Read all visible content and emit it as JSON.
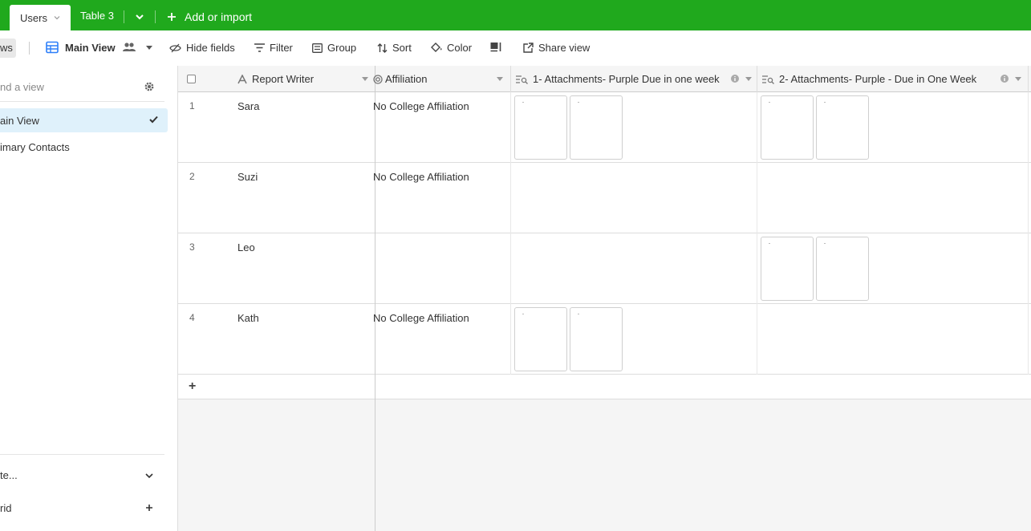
{
  "tabs": {
    "active": "Users",
    "other": "Table 3",
    "add_import": "Add or import"
  },
  "toolbar": {
    "views_label": "ws",
    "view_name": "Main View",
    "hide_fields": "Hide fields",
    "filter": "Filter",
    "group": "Group",
    "sort": "Sort",
    "color": "Color",
    "share_view": "Share view"
  },
  "sidebar": {
    "find_placeholder": "nd a view",
    "items": [
      {
        "label": "ain View",
        "active": true
      },
      {
        "label": "imary Contacts",
        "active": false
      }
    ],
    "bottom": [
      {
        "label": "te...",
        "icon": "chevron-down-icon"
      },
      {
        "label": "rid",
        "icon": "plus-icon"
      }
    ]
  },
  "grid": {
    "columns": [
      {
        "label": "Report Writer",
        "icon": "text-field-icon"
      },
      {
        "label": "Affiliation",
        "icon": "link-field-icon"
      },
      {
        "label": "1- Attachments- Purple Due in one week",
        "icon": "lookup-field-icon"
      },
      {
        "label": "2- Attachments- Purple - Due in One Week",
        "icon": "lookup-field-icon"
      }
    ],
    "rows": [
      {
        "num": "1",
        "writer": "Sara",
        "affiliation": "No College Affiliation",
        "att1": 2,
        "att2": 2
      },
      {
        "num": "2",
        "writer": "Suzi",
        "affiliation": "No College Affiliation",
        "att1": 0,
        "att2": 0
      },
      {
        "num": "3",
        "writer": "Leo",
        "affiliation": "",
        "att1": 0,
        "att2": 2
      },
      {
        "num": "4",
        "writer": "Kath",
        "affiliation": "No College Affiliation",
        "att1": 2,
        "att2": 0
      }
    ],
    "add_row": "+"
  },
  "colors": {
    "topbar": "#20a91d",
    "active_view_bg": "#dff1fb",
    "grid_view_icon": "#2d7ff9"
  }
}
